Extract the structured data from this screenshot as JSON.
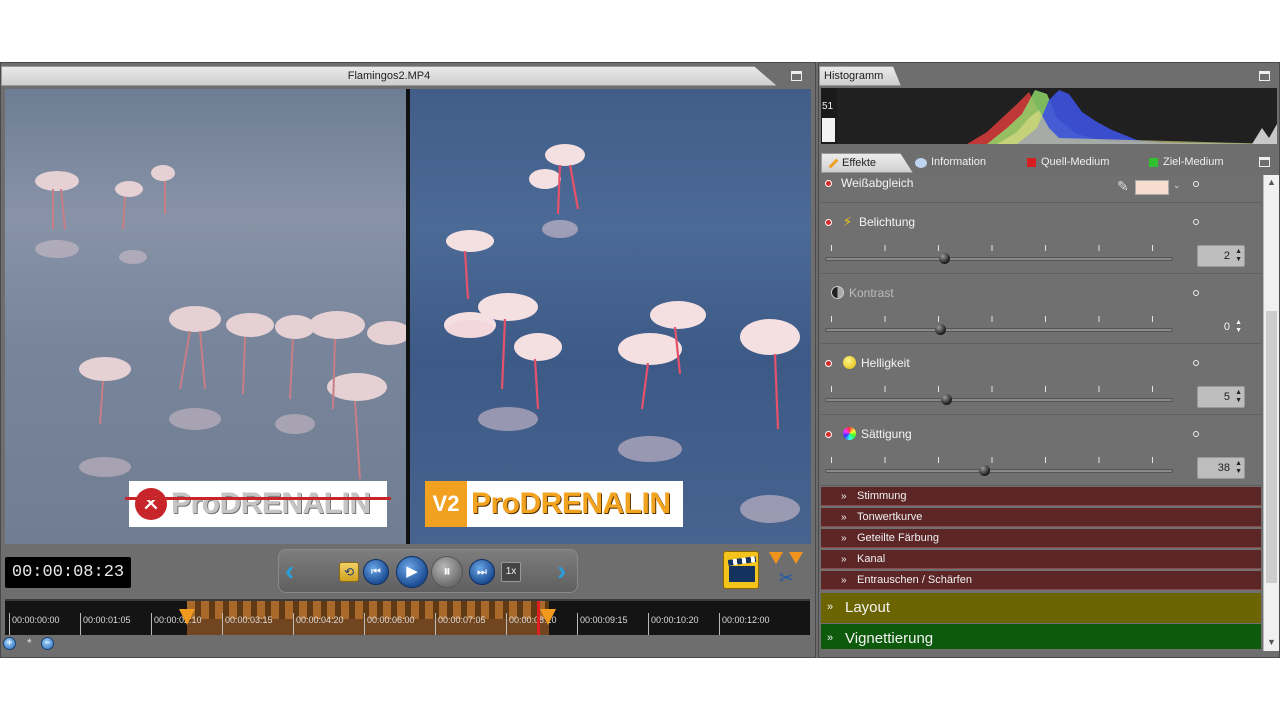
{
  "player": {
    "file_name": "Flamingos2.MP4",
    "timecode": "00:00:08:23",
    "speed": "1x",
    "badge_before": "ProDRENALIN",
    "badge_after_prefix": "V2",
    "badge_after": "ProDRENALIN"
  },
  "timeline": {
    "labels": [
      "00:00:00:00",
      "00:00:01:05",
      "00:00:02:10",
      "00:00:03:15",
      "00:00:04:20",
      "00:00:06:00",
      "00:00:07:05",
      "00:00:08:10",
      "00:00:09:15",
      "00:00:10:20",
      "00:00:12:00"
    ]
  },
  "histogram": {
    "title": "Histogramm",
    "scale_value": "51"
  },
  "tabs": [
    {
      "label": "Effekte",
      "icon": "effects-wand-icon",
      "color": "#f0a020"
    },
    {
      "label": "Information",
      "icon": "speech-bubble-icon",
      "color": "#bcd4f0"
    },
    {
      "label": "Quell-Medium",
      "icon": "red-square-icon",
      "color": "#d62020"
    },
    {
      "label": "Ziel-Medium",
      "icon": "green-square-icon",
      "color": "#30c030"
    }
  ],
  "effects": {
    "white_balance": {
      "label": "Weißabgleich",
      "swatch_color": "#f7dcd0"
    },
    "exposure": {
      "label": "Belichtung",
      "value": "2"
    },
    "contrast": {
      "label": "Kontrast",
      "value": "0"
    },
    "brightness": {
      "label": "Helligkeit",
      "value": "5"
    },
    "saturation": {
      "label": "Sättigung",
      "value": "38"
    }
  },
  "groups": [
    "Stimmung",
    "Tonwertkurve",
    "Geteilte Färbung",
    "Kanal",
    "Entrauschen / Schärfen"
  ],
  "sections": {
    "layout": {
      "label": "Layout",
      "color": "#6b6400"
    },
    "vignetting": {
      "label": "Vignettierung",
      "color": "#0d5a0d"
    }
  }
}
